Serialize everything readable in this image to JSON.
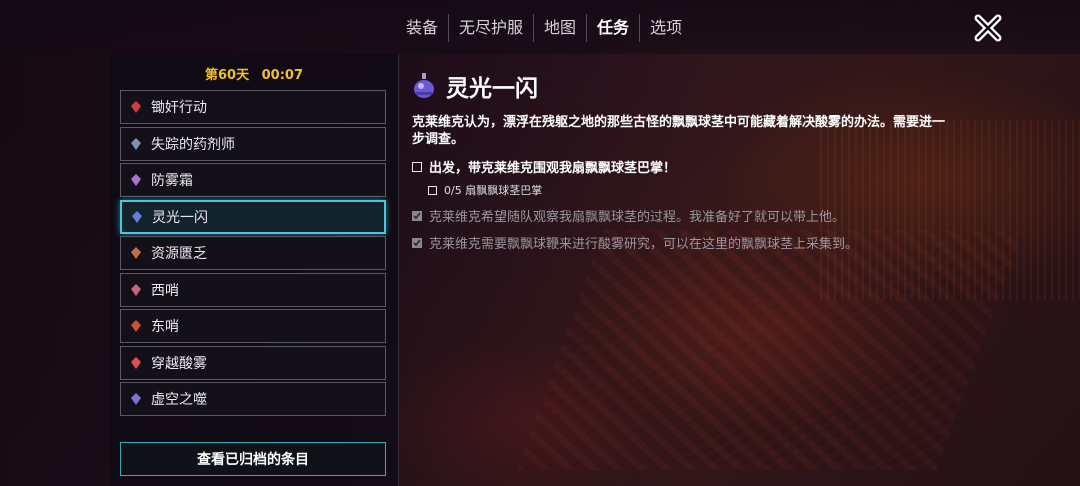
{
  "nav": {
    "tabs": [
      "装备",
      "无尽护服",
      "地图",
      "任务",
      "选项"
    ],
    "active_tab": "任务"
  },
  "timer": {
    "day": "第60天",
    "time": "00:07"
  },
  "quests": [
    {
      "label": "锄奸行动",
      "icon": "red-sword-icon",
      "color": "#d04040"
    },
    {
      "label": "失踪的药剂师",
      "icon": "blue-bird-icon",
      "color": "#8090b0"
    },
    {
      "label": "防雾霜",
      "icon": "purple-jar-icon",
      "color": "#b070d0"
    },
    {
      "label": "灵光一闪",
      "icon": "blue-flask-icon",
      "color": "#6080e0"
    },
    {
      "label": "资源匮乏",
      "icon": "crate-icon",
      "color": "#c07040"
    },
    {
      "label": "西哨",
      "icon": "helmet-icon",
      "color": "#d06080"
    },
    {
      "label": "东哨",
      "icon": "flame-icon",
      "color": "#d05030"
    },
    {
      "label": "穿越酸雾",
      "icon": "crystal-icon",
      "color": "#e05050"
    },
    {
      "label": "虚空之噬",
      "icon": "flag-icon",
      "color": "#8070d0"
    }
  ],
  "selected_quest_index": 3,
  "archive_button": "查看已归档的条目",
  "detail": {
    "title": "灵光一闪",
    "description": "克莱维克认为，漂浮在残躯之地的那些古怪的飘飘球茎中可能藏着解决酸雾的办法。需要进一步调查。",
    "objective_main": "出发，带克莱维克围观我扇飘飘球茎巴掌！",
    "objective_sub": "0/5 扇飘飘球茎巴掌",
    "completed": [
      "克莱维克希望随队观察我扇飘飘球茎的过程。我准备好了就可以带上他。",
      "克莱维克需要飘飘球鞭来进行酸雾研究，可以在这里的飘飘球茎上采集到。"
    ]
  },
  "colors": {
    "accent": "#45c8d8",
    "timer": "#f0c030"
  }
}
